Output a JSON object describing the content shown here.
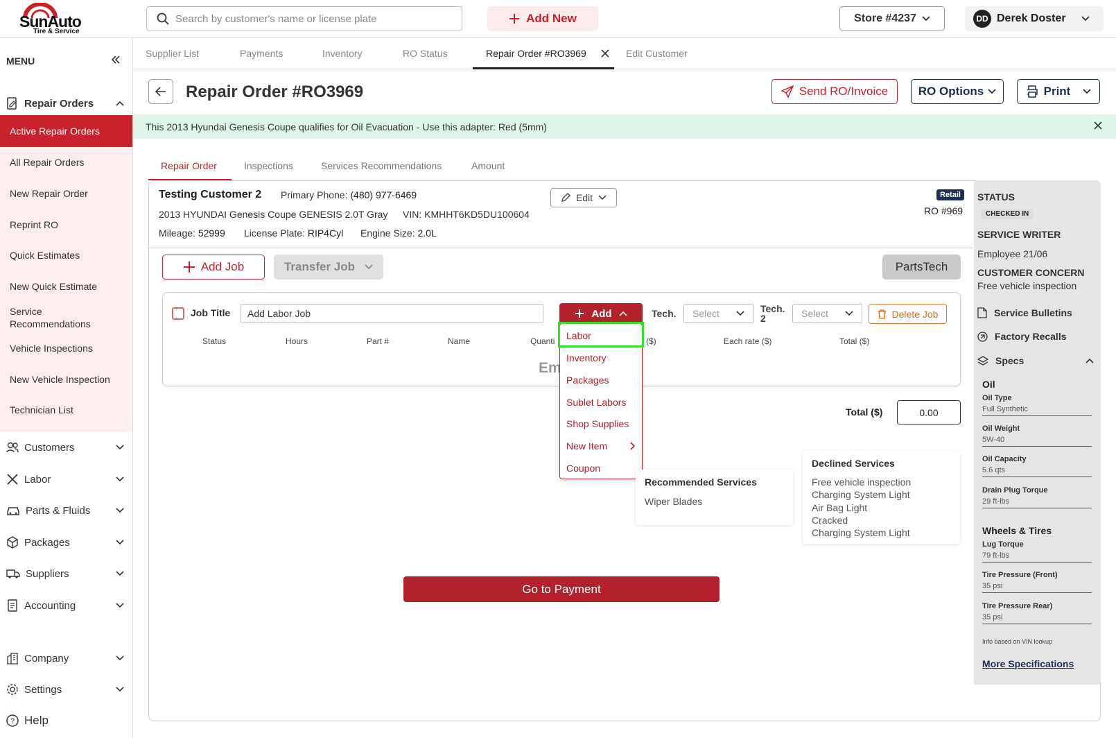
{
  "brand": {
    "name": "SunAuto",
    "tagline": "Tire & Service",
    "accent": "#c8232c"
  },
  "topbar": {
    "search_placeholder": "Search by customer's name or license plate",
    "add_new_label": "Add New",
    "store_label": "Store #4237",
    "user_initials": "DD",
    "user_name": "Derek Doster"
  },
  "sidebar": {
    "menu_label": "MENU",
    "repair_orders_label": "Repair Orders",
    "sub_items": [
      "Active Repair Orders",
      "All Repair Orders",
      "New Repair Order",
      "Reprint RO",
      "Quick Estimates",
      "New Quick Estimate",
      "Service Recommendations",
      "Vehicle Inspections",
      "New Vehicle Inspection",
      "Technician List"
    ],
    "sections": [
      "Customers",
      "Labor",
      "Parts & Fluids",
      "Packages",
      "Suppliers",
      "Accounting",
      "Company",
      "Settings",
      "Help"
    ]
  },
  "tabs": [
    "Supplier List",
    "Payments",
    "Inventory",
    "RO Status",
    "Repair Order #RO3969",
    "Edit Customer"
  ],
  "header": {
    "title": "Repair Order #RO3969",
    "send_label": "Send RO/Invoice",
    "ro_options_label": "RO Options",
    "print_label": "Print"
  },
  "banner": {
    "text": "This 2013 Hyundai Genesis Coupe qualifies for Oil Evacuation - Use this adapter: Red (5mm)"
  },
  "ro_tabs": [
    "Repair Order",
    "Inspections",
    "Services Recommendations",
    "Amount"
  ],
  "customer": {
    "name": "Testing Customer 2",
    "phone_label": "Primary Phone:",
    "phone": "(480) 977-6469",
    "vehicle": "2013 HYUNDAI Genesis Coupe GENESIS 2.0T Gray",
    "vin_label": "VIN:",
    "vin": "KMHHT6KD5DU100604",
    "mileage_label": "Mileage:",
    "mileage": "52999",
    "plate_label": "License Plate:",
    "plate": "RIP4Cyl",
    "engine_label": "Engine Size:",
    "engine": "2.0L",
    "edit_label": "Edit",
    "retail_badge": "Retail",
    "ro_number": "RO #969"
  },
  "actions": {
    "add_job": "Add Job",
    "transfer_job": "Transfer Job",
    "partstech": "PartsTech"
  },
  "job": {
    "title_label": "Job Title",
    "title_value": "Add Labor Job",
    "add_label": "Add",
    "tech_label": "Tech.",
    "tech2_label_a": "Tech.",
    "tech2_label_b": "2",
    "select_placeholder": "Select",
    "delete_label": "Delete Job",
    "columns": [
      "Status",
      "Hours",
      "Part #",
      "Name",
      "Quanti",
      "($)",
      "Each rate ($)",
      "Total ($)"
    ],
    "empty_text": "Em"
  },
  "add_menu": {
    "items": [
      "Labor",
      "Inventory",
      "Packages",
      "Sublet Labors",
      "Shop Supplies",
      "New Item",
      "Coupon"
    ]
  },
  "total": {
    "label": "Total ($)",
    "value": "0.00"
  },
  "recommended": {
    "title": "Recommended Services",
    "items": [
      "Wiper Blades"
    ]
  },
  "declined": {
    "title": "Declined Services",
    "items": [
      "Free vehicle inspection",
      "Charging System Light",
      "Air Bag Light",
      "Cracked",
      "Charging System Light"
    ]
  },
  "go_to_payment": "Go to Payment",
  "status_panel": {
    "status_label": "STATUS",
    "status_value": "CHECKED IN",
    "writer_label": "SERVICE WRITER",
    "writer_value": "Employee 21/06",
    "concern_label": "CUSTOMER CONCERN",
    "concern_value": "Free vehicle inspection",
    "bulletins": "Service Bulletins",
    "recalls": "Factory Recalls",
    "specs_label": "Specs",
    "oil_group": "Oil",
    "oil_specs": [
      {
        "name": "Oil Type",
        "value": "Full Synthetic"
      },
      {
        "name": "Oil Weight",
        "value": "5W-40"
      },
      {
        "name": "Oil Capacity",
        "value": "5.6 qts"
      },
      {
        "name": "Drain Plug Torque",
        "value": "29 ft-lbs"
      }
    ],
    "wheels_group": "Wheels & Tires",
    "wheel_specs": [
      {
        "name": "Lug Torque",
        "value": "79 ft-lbs"
      },
      {
        "name": "Tire Pressure (Front)",
        "value": "35 psi"
      },
      {
        "name": "Tire Pressure Rear)",
        "value": "35 psi"
      }
    ],
    "vin_note": "Info based on VIN lookup",
    "more_specs": "More Specifications"
  }
}
